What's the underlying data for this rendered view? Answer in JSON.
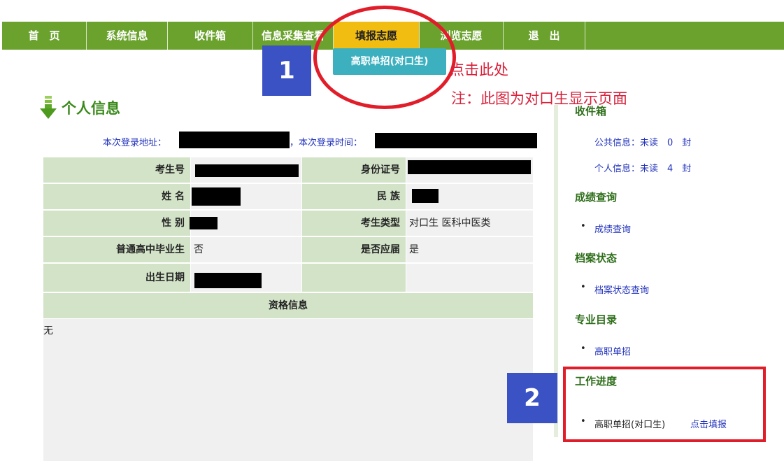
{
  "nav": {
    "items": [
      "首　页",
      "系统信息",
      "收件箱",
      "信息采集查看",
      "填报志愿",
      "浏览志愿",
      "退　出"
    ],
    "dropdown_item": "高职单招(对口生)"
  },
  "annotations": {
    "badge1": "1",
    "badge2": "2",
    "click_here": "点击此处",
    "note": "注：此图为对口生显示页面"
  },
  "page": {
    "title": "个人信息",
    "login_address_label": "本次登录地址：",
    "login_time_label": "，本次登录时间："
  },
  "info": {
    "exam_no_label": "考生号",
    "id_label": "身份证号",
    "name_label": "姓 名",
    "ethnic_label": "民 族",
    "gender_label": "性 别",
    "type_label": "考生类型",
    "type_value": "对口生 医科中医类",
    "hs_grad_label": "普通高中毕业生",
    "hs_grad_value": "否",
    "current_label": "是否应届",
    "current_value": "是",
    "birth_label": "出生日期"
  },
  "qualification": {
    "header": "资格信息",
    "value": "无"
  },
  "sidebar": {
    "inbox_head": "收件箱",
    "public_info": "公共信息：未读　0　封",
    "personal_info": "个人信息：未读　4　封",
    "score_head": "成绩查询",
    "score_link": "成绩查询",
    "archive_head": "档案状态",
    "archive_link": "档案状态查询",
    "major_head": "专业目录",
    "major_link": "高职单招",
    "progress_head": "工作进度",
    "progress_item": "高职单招(对口生)",
    "progress_link": "点击填报"
  },
  "colors": {
    "nav": "#6aa22d",
    "nav_active": "#f2bd11",
    "dropdown": "#3cb0bf",
    "badge": "#3b52c4",
    "annotation": "#e11d2a"
  }
}
